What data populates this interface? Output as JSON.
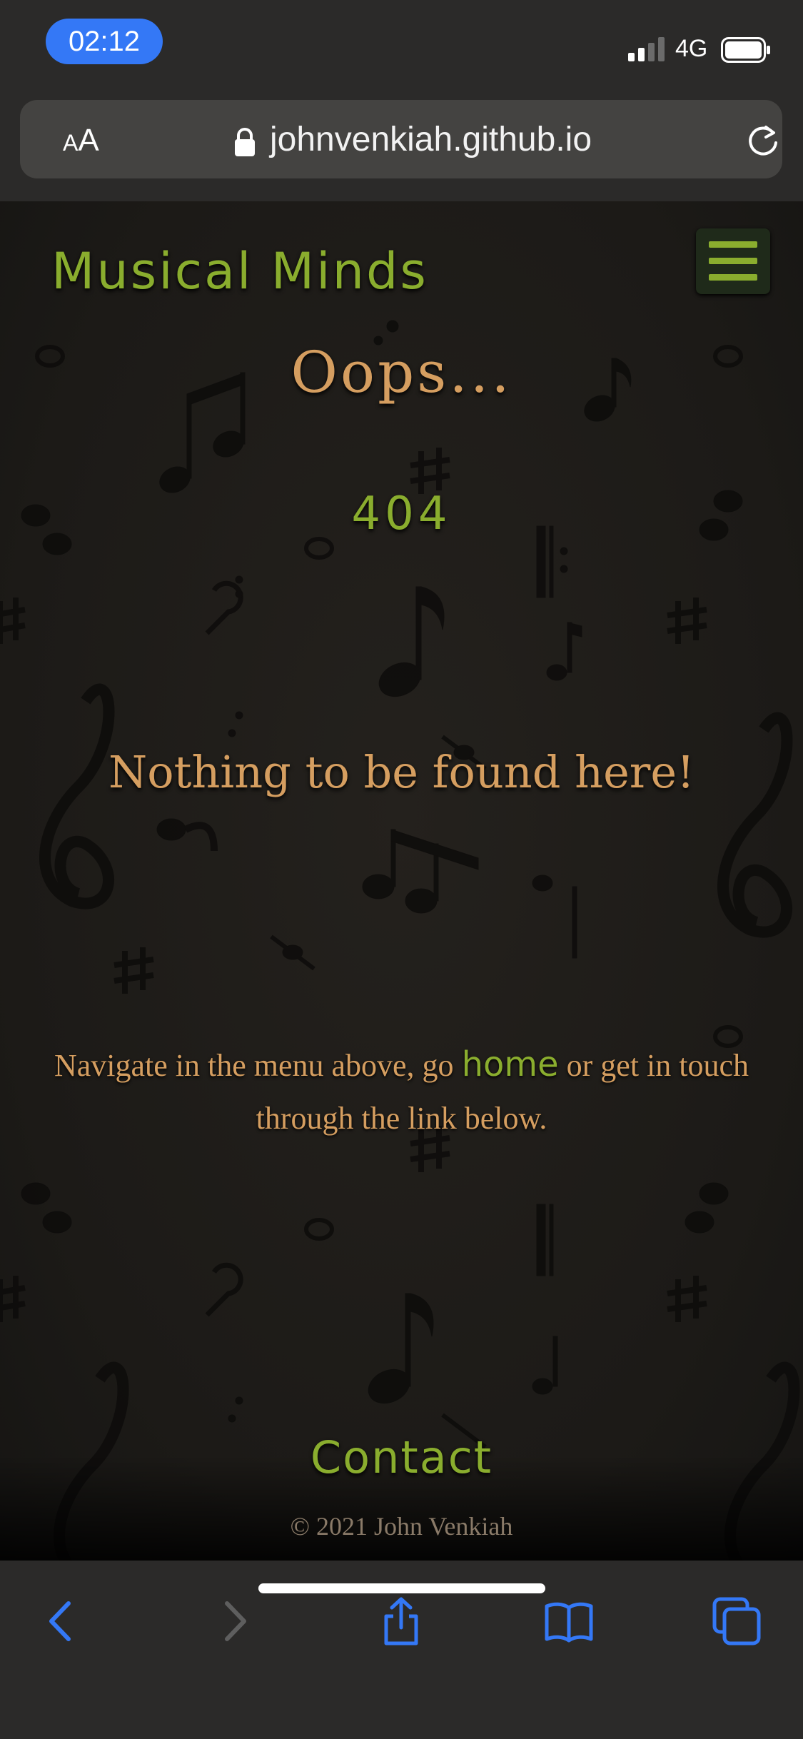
{
  "status_bar": {
    "time": "02:12",
    "network": "4G",
    "signal_bars": 2,
    "accent_color": "#3478f6"
  },
  "browser": {
    "text_size_label_small": "A",
    "text_size_label_large": "A",
    "url": "johnvenkiah.github.io",
    "icons": [
      "lock-icon",
      "reload-icon",
      "back-icon",
      "forward-icon",
      "share-icon",
      "bookmarks-icon",
      "tabs-icon"
    ]
  },
  "site": {
    "title": "Musical Minds",
    "menu_icon": "hamburger-icon",
    "accent_green": "#8aad2e",
    "accent_orange": "#d59e60"
  },
  "main": {
    "heading": "Oops...",
    "code": "404",
    "message": "Nothing to be found here!",
    "navigate_before": "Navigate in the menu above, go ",
    "home_link": "home",
    "navigate_after": " or get in touch through the link below."
  },
  "footer": {
    "contact_link": "Contact",
    "copyright": "© 2021 John Venkiah"
  }
}
